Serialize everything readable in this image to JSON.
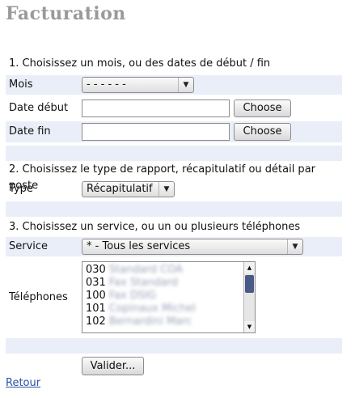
{
  "page": {
    "title": "Facturation"
  },
  "section1": {
    "heading": "1. Choisissez un mois, ou des dates de début / fin",
    "month_label": "Mois",
    "month_value": "- - - - - -",
    "start_label": "Date début",
    "start_value": "",
    "end_label": "Date fin",
    "end_value": "",
    "choose_label": "Choose"
  },
  "section2": {
    "heading": "2. Choisissez le type de rapport, récapitulatif ou détail par poste",
    "type_label": "Type",
    "type_value": "Récapitulatif"
  },
  "section3": {
    "heading": "3. Choisissez un service, ou un ou plusieurs téléphones",
    "service_label": "Service",
    "service_value": "* - Tous les services",
    "phones_label": "Téléphones",
    "phones": [
      {
        "code": "030",
        "name": "Standard COA"
      },
      {
        "code": "031",
        "name": "Fax Standard"
      },
      {
        "code": "100",
        "name": "Fax DSIG"
      },
      {
        "code": "101",
        "name": "Copinaux Michel"
      },
      {
        "code": "102",
        "name": "Bernardini Marc"
      }
    ]
  },
  "actions": {
    "submit_label": "Valider...",
    "back_label": "Retour"
  }
}
